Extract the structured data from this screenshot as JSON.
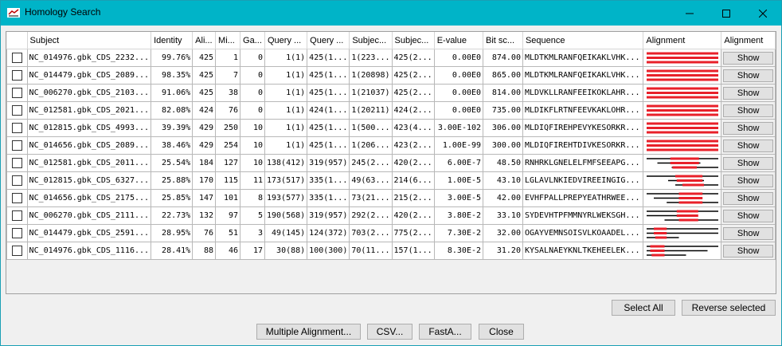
{
  "window": {
    "title": "Homology Search"
  },
  "columns": [
    "",
    "Subject",
    "Identity",
    "Ali...",
    "Mi...",
    "Ga...",
    "Query ...",
    "Query ...",
    "Subjec...",
    "Subjec...",
    "E-value",
    "Bit sc...",
    "Sequence",
    "Alignment",
    "Alignment"
  ],
  "colors": {
    "match": "#e8202a",
    "line": "#000000",
    "titlebar": "#00b4c8"
  },
  "rows": [
    {
      "subject": "NC_014976.gbk_CDS_2232...",
      "identity": "99.76%",
      "ali": "425",
      "mi": "1",
      "ga": "0",
      "qs": "1(1)",
      "qe": "425(1...",
      "ss": "1(223...",
      "se": "425(2...",
      "evalue": "0.00E0",
      "bit": "874.00",
      "seq": "MLDTKMLRANFQEIKAKLVHK...",
      "show": "Show",
      "alignment": {
        "lines": [
          {
            "from": 0,
            "to": 1
          },
          {
            "from": 0,
            "to": 1
          },
          {
            "from": 0,
            "to": 1
          }
        ],
        "hits": [
          {
            "from": 0,
            "to": 1
          },
          {
            "from": 0,
            "to": 1
          },
          {
            "from": 0,
            "to": 1
          }
        ]
      }
    },
    {
      "subject": "NC_014479.gbk_CDS_2089...",
      "identity": "98.35%",
      "ali": "425",
      "mi": "7",
      "ga": "0",
      "qs": "1(1)",
      "qe": "425(1...",
      "ss": "1(20898)",
      "se": "425(2...",
      "evalue": "0.00E0",
      "bit": "865.00",
      "seq": "MLDTKMLRANFQEIKAKLVHK...",
      "show": "Show",
      "alignment": {
        "lines": [
          {
            "from": 0,
            "to": 1
          },
          {
            "from": 0,
            "to": 1
          },
          {
            "from": 0,
            "to": 1
          }
        ],
        "hits": [
          {
            "from": 0,
            "to": 1
          },
          {
            "from": 0,
            "to": 1
          },
          {
            "from": 0,
            "to": 1
          }
        ]
      }
    },
    {
      "subject": "NC_006270.gbk_CDS_2103...",
      "identity": "91.06%",
      "ali": "425",
      "mi": "38",
      "ga": "0",
      "qs": "1(1)",
      "qe": "425(1...",
      "ss": "1(21037)",
      "se": "425(2...",
      "evalue": "0.00E0",
      "bit": "814.00",
      "seq": "MLDVKLLRANFEEIKOKLAHR...",
      "show": "Show",
      "alignment": {
        "lines": [
          {
            "from": 0,
            "to": 1
          },
          {
            "from": 0,
            "to": 1
          },
          {
            "from": 0,
            "to": 1
          }
        ],
        "hits": [
          {
            "from": 0,
            "to": 1
          },
          {
            "from": 0,
            "to": 1
          },
          {
            "from": 0,
            "to": 1
          }
        ]
      }
    },
    {
      "subject": "NC_012581.gbk_CDS_2021...",
      "identity": "82.08%",
      "ali": "424",
      "mi": "76",
      "ga": "0",
      "qs": "1(1)",
      "qe": "424(1...",
      "ss": "1(20211)",
      "se": "424(2...",
      "evalue": "0.00E0",
      "bit": "735.00",
      "seq": "MLDIKFLRTNFEEVKAKLOHR...",
      "show": "Show",
      "alignment": {
        "lines": [
          {
            "from": 0,
            "to": 1
          },
          {
            "from": 0,
            "to": 1
          },
          {
            "from": 0,
            "to": 1
          }
        ],
        "hits": [
          {
            "from": 0,
            "to": 1
          },
          {
            "from": 0,
            "to": 1
          },
          {
            "from": 0,
            "to": 1
          }
        ]
      }
    },
    {
      "subject": "NC_012815.gbk_CDS_4993...",
      "identity": "39.39%",
      "ali": "429",
      "mi": "250",
      "ga": "10",
      "qs": "1(1)",
      "qe": "425(1...",
      "ss": "1(500...",
      "se": "423(4...",
      "evalue": "3.00E-102",
      "bit": "306.00",
      "seq": "MLDIQFIREHPEVYKESORKR...",
      "show": "Show",
      "alignment": {
        "lines": [
          {
            "from": 0,
            "to": 1
          },
          {
            "from": 0,
            "to": 1
          },
          {
            "from": 0,
            "to": 1
          }
        ],
        "hits": [
          {
            "from": 0,
            "to": 1
          },
          {
            "from": 0,
            "to": 1
          },
          {
            "from": 0,
            "to": 1
          }
        ]
      }
    },
    {
      "subject": "NC_014656.gbk_CDS_2089...",
      "identity": "38.46%",
      "ali": "429",
      "mi": "254",
      "ga": "10",
      "qs": "1(1)",
      "qe": "425(1...",
      "ss": "1(206...",
      "se": "423(2...",
      "evalue": "1.00E-99",
      "bit": "300.00",
      "seq": "MLDIQFIREHTDIVKESORKR...",
      "show": "Show",
      "alignment": {
        "lines": [
          {
            "from": 0,
            "to": 1
          },
          {
            "from": 0,
            "to": 1
          },
          {
            "from": 0,
            "to": 1
          }
        ],
        "hits": [
          {
            "from": 0,
            "to": 1
          },
          {
            "from": 0,
            "to": 1
          },
          {
            "from": 0,
            "to": 1
          }
        ]
      }
    },
    {
      "subject": "NC_012581.gbk_CDS_2011...",
      "identity": "25.54%",
      "ali": "184",
      "mi": "127",
      "ga": "10",
      "qs": "138(412)",
      "qe": "319(957)",
      "ss": "245(2...",
      "se": "420(2...",
      "evalue": "6.00E-7",
      "bit": "48.50",
      "seq": "RNHRKLGNELELFMFSEEAPG...",
      "show": "Show",
      "alignment": {
        "lines": [
          {
            "from": 0,
            "to": 1
          },
          {
            "from": 0.15,
            "to": 0.75
          },
          {
            "from": 0.35,
            "to": 1
          }
        ],
        "hits": [
          {
            "from": 0.33,
            "to": 0.73
          },
          {
            "from": 0.33,
            "to": 0.73
          },
          {
            "from": 0.36,
            "to": 0.7
          }
        ]
      }
    },
    {
      "subject": "NC_012815.gbk_CDS_6327...",
      "identity": "25.88%",
      "ali": "170",
      "mi": "115",
      "ga": "11",
      "qs": "173(517)",
      "qe": "335(1...",
      "ss": "49(63...",
      "se": "214(6...",
      "evalue": "1.00E-5",
      "bit": "43.10",
      "seq": "LGLAVLNKIEDVIREEINGIG...",
      "show": "Show",
      "alignment": {
        "lines": [
          {
            "from": 0,
            "to": 1
          },
          {
            "from": 0.3,
            "to": 0.8
          },
          {
            "from": 0.4,
            "to": 1
          }
        ],
        "hits": [
          {
            "from": 0.4,
            "to": 0.78
          },
          {
            "from": 0.42,
            "to": 0.78
          },
          {
            "from": 0.5,
            "to": 0.8
          }
        ]
      }
    },
    {
      "subject": "NC_014656.gbk_CDS_2175...",
      "identity": "25.85%",
      "ali": "147",
      "mi": "101",
      "ga": "8",
      "qs": "193(577)",
      "qe": "335(1...",
      "ss": "73(21...",
      "se": "215(2...",
      "evalue": "3.00E-5",
      "bit": "42.00",
      "seq": "EVHFPALLPREPYEATHRWEE...",
      "show": "Show",
      "alignment": {
        "lines": [
          {
            "from": 0,
            "to": 1
          },
          {
            "from": 0.1,
            "to": 0.75
          },
          {
            "from": 0.28,
            "to": 1
          }
        ],
        "hits": [
          {
            "from": 0.45,
            "to": 0.78
          },
          {
            "from": 0.45,
            "to": 0.78
          },
          {
            "from": 0.45,
            "to": 0.78
          }
        ]
      }
    },
    {
      "subject": "NC_006270.gbk_CDS_2111...",
      "identity": "22.73%",
      "ali": "132",
      "mi": "97",
      "ga": "5",
      "qs": "190(568)",
      "qe": "319(957)",
      "ss": "292(2...",
      "se": "420(2...",
      "evalue": "3.80E-2",
      "bit": "33.10",
      "seq": "SYDEVHTPFMMNYRLWEKSGH...",
      "show": "Show",
      "alignment": {
        "lines": [
          {
            "from": 0,
            "to": 1
          },
          {
            "from": 0,
            "to": 0.7
          },
          {
            "from": 0.25,
            "to": 1
          }
        ],
        "hits": [
          {
            "from": 0.42,
            "to": 0.72
          },
          {
            "from": 0.42,
            "to": 0.72
          },
          {
            "from": 0.45,
            "to": 0.72
          }
        ]
      }
    },
    {
      "subject": "NC_014479.gbk_CDS_2591...",
      "identity": "28.95%",
      "ali": "76",
      "mi": "51",
      "ga": "3",
      "qs": "49(145)",
      "qe": "124(372)",
      "ss": "703(2...",
      "se": "775(2...",
      "evalue": "7.30E-2",
      "bit": "32.00",
      "seq": "OGAYVEMNSOISVLKOAADEL...",
      "show": "Show",
      "alignment": {
        "lines": [
          {
            "from": 0,
            "to": 1
          },
          {
            "from": 0,
            "to": 1
          },
          {
            "from": 0,
            "to": 0.45
          }
        ],
        "hits": [
          {
            "from": 0.1,
            "to": 0.28
          },
          {
            "from": 0.1,
            "to": 0.28
          },
          {
            "from": 0.12,
            "to": 0.28
          }
        ]
      }
    },
    {
      "subject": "NC_014976.gbk_CDS_1116...",
      "identity": "28.41%",
      "ali": "88",
      "mi": "46",
      "ga": "17",
      "qs": "30(88)",
      "qe": "100(300)",
      "ss": "70(11...",
      "se": "157(1...",
      "evalue": "8.30E-2",
      "bit": "31.20",
      "seq": "KYSALNAEYKNLTKEHEELEK...",
      "show": "Show",
      "alignment": {
        "lines": [
          {
            "from": 0,
            "to": 1
          },
          {
            "from": 0,
            "to": 0.85
          },
          {
            "from": 0,
            "to": 0.55
          }
        ],
        "hits": [
          {
            "from": 0.05,
            "to": 0.25
          },
          {
            "from": 0.05,
            "to": 0.25
          },
          {
            "from": 0.07,
            "to": 0.25
          }
        ]
      }
    }
  ],
  "buttons": {
    "select_all": "Select All",
    "reverse_selected": "Reverse selected",
    "multiple_alignment": "Multiple Alignment...",
    "csv": "CSV...",
    "fasta": "FastA...",
    "close": "Close"
  }
}
